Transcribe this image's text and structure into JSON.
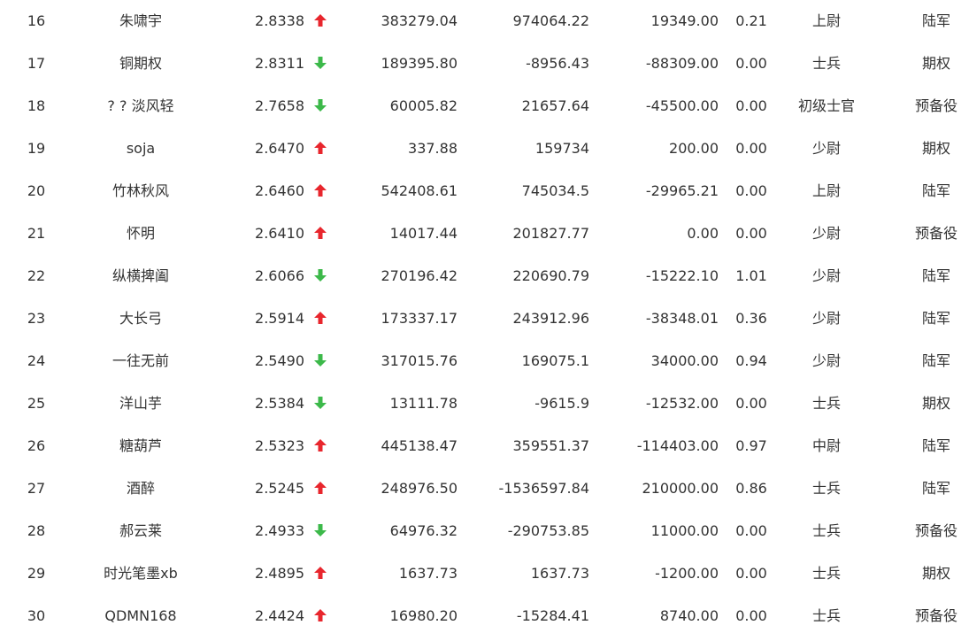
{
  "colors": {
    "up": "#e8262d",
    "down": "#3cb94a",
    "text": "#333333"
  },
  "rows": [
    {
      "rank": "16",
      "name": "朱啸宇",
      "score": "2.8338",
      "trend": "up",
      "v1": "383279.04",
      "v2": "974064.22",
      "v3": "19349.00",
      "v4": "0.21",
      "title": "上尉",
      "category": "陆军"
    },
    {
      "rank": "17",
      "name": "铜期权",
      "score": "2.8311",
      "trend": "down",
      "v1": "189395.80",
      "v2": "-8956.43",
      "v3": "-88309.00",
      "v4": "0.00",
      "title": "士兵",
      "category": "期权"
    },
    {
      "rank": "18",
      "name": "? ? 淡风轻",
      "score": "2.7658",
      "trend": "down",
      "v1": "60005.82",
      "v2": "21657.64",
      "v3": "-45500.00",
      "v4": "0.00",
      "title": "初级士官",
      "category": "预备役"
    },
    {
      "rank": "19",
      "name": "soja",
      "score": "2.6470",
      "trend": "up",
      "v1": "337.88",
      "v2": "159734",
      "v3": "200.00",
      "v4": "0.00",
      "title": "少尉",
      "category": "期权"
    },
    {
      "rank": "20",
      "name": "竹林秋风",
      "score": "2.6460",
      "trend": "up",
      "v1": "542408.61",
      "v2": "745034.5",
      "v3": "-29965.21",
      "v4": "0.00",
      "title": "上尉",
      "category": "陆军"
    },
    {
      "rank": "21",
      "name": "怀明",
      "score": "2.6410",
      "trend": "up",
      "v1": "14017.44",
      "v2": "201827.77",
      "v3": "0.00",
      "v4": "0.00",
      "title": "少尉",
      "category": "预备役"
    },
    {
      "rank": "22",
      "name": "纵横捭阖",
      "score": "2.6066",
      "trend": "down",
      "v1": "270196.42",
      "v2": "220690.79",
      "v3": "-15222.10",
      "v4": "1.01",
      "title": "少尉",
      "category": "陆军"
    },
    {
      "rank": "23",
      "name": "大长弓",
      "score": "2.5914",
      "trend": "up",
      "v1": "173337.17",
      "v2": "243912.96",
      "v3": "-38348.01",
      "v4": "0.36",
      "title": "少尉",
      "category": "陆军"
    },
    {
      "rank": "24",
      "name": "一往无前",
      "score": "2.5490",
      "trend": "down",
      "v1": "317015.76",
      "v2": "169075.1",
      "v3": "34000.00",
      "v4": "0.94",
      "title": "少尉",
      "category": "陆军"
    },
    {
      "rank": "25",
      "name": "洋山芋",
      "score": "2.5384",
      "trend": "down",
      "v1": "13111.78",
      "v2": "-9615.9",
      "v3": "-12532.00",
      "v4": "0.00",
      "title": "士兵",
      "category": "期权"
    },
    {
      "rank": "26",
      "name": "糖葫芦",
      "score": "2.5323",
      "trend": "up",
      "v1": "445138.47",
      "v2": "359551.37",
      "v3": "-114403.00",
      "v4": "0.97",
      "title": "中尉",
      "category": "陆军"
    },
    {
      "rank": "27",
      "name": "酒醉",
      "score": "2.5245",
      "trend": "up",
      "v1": "248976.50",
      "v2": "-1536597.84",
      "v3": "210000.00",
      "v4": "0.86",
      "title": "士兵",
      "category": "陆军"
    },
    {
      "rank": "28",
      "name": "郝云莱",
      "score": "2.4933",
      "trend": "down",
      "v1": "64976.32",
      "v2": "-290753.85",
      "v3": "11000.00",
      "v4": "0.00",
      "title": "士兵",
      "category": "预备役"
    },
    {
      "rank": "29",
      "name": "时光笔墨xb",
      "score": "2.4895",
      "trend": "up",
      "v1": "1637.73",
      "v2": "1637.73",
      "v3": "-1200.00",
      "v4": "0.00",
      "title": "士兵",
      "category": "期权"
    },
    {
      "rank": "30",
      "name": "QDMN168",
      "score": "2.4424",
      "trend": "up",
      "v1": "16980.20",
      "v2": "-15284.41",
      "v3": "8740.00",
      "v4": "0.00",
      "title": "士兵",
      "category": "预备役"
    }
  ]
}
